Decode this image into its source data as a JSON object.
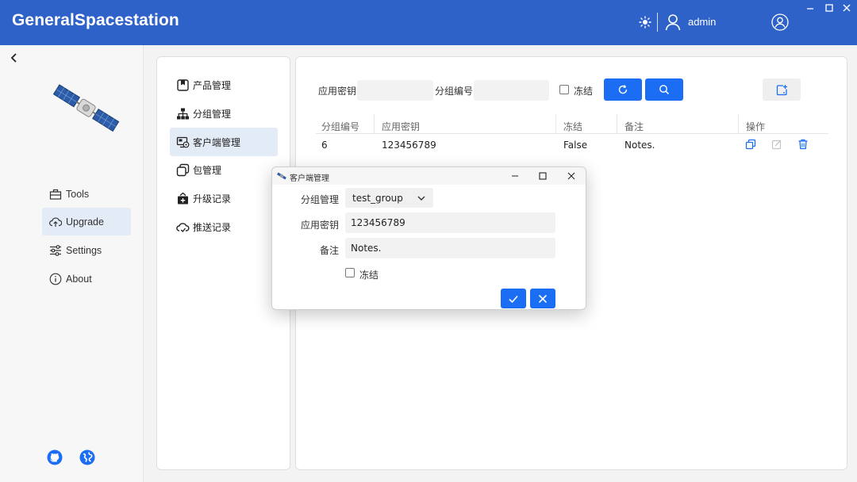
{
  "app": {
    "title": "GeneralSpacestation",
    "user": "admin"
  },
  "sidebar": {
    "items": [
      {
        "label": "Tools",
        "icon": "toolbox-icon"
      },
      {
        "label": "Upgrade",
        "icon": "cloud-upload-icon",
        "active": true
      },
      {
        "label": "Settings",
        "icon": "sliders-icon"
      },
      {
        "label": "About",
        "icon": "info-icon"
      }
    ]
  },
  "submenu": {
    "items": [
      {
        "label": "产品管理",
        "icon": "product-icon"
      },
      {
        "label": "分组管理",
        "icon": "hierarchy-icon"
      },
      {
        "label": "客户端管理",
        "icon": "client-icon",
        "active": true
      },
      {
        "label": "包管理",
        "icon": "package-icon"
      },
      {
        "label": "升级记录",
        "icon": "upgrade-record-icon"
      },
      {
        "label": "推送记录",
        "icon": "push-record-icon"
      }
    ]
  },
  "filters": {
    "app_key_label": "应用密钥",
    "app_key_value": "",
    "group_id_label": "分组编号",
    "group_id_value": "",
    "frozen_label": "冻结",
    "frozen_checked": false
  },
  "table": {
    "headers": [
      "分组编号",
      "应用密钥",
      "冻结",
      "备注",
      "操作"
    ],
    "rows": [
      {
        "group_id": "6",
        "app_key": "123456789",
        "frozen": "False",
        "notes": "Notes."
      }
    ]
  },
  "dialog": {
    "title": "客户端管理",
    "group_label": "分组管理",
    "group_value": "test_group",
    "app_key_label": "应用密钥",
    "app_key_value": "123456789",
    "notes_label": "备注",
    "notes_value": "Notes.",
    "frozen_label": "冻结",
    "frozen_checked": false
  },
  "colors": {
    "brand": "#2f62c8",
    "accent": "#1b6ef3",
    "active_bg": "#e3ebf6"
  }
}
